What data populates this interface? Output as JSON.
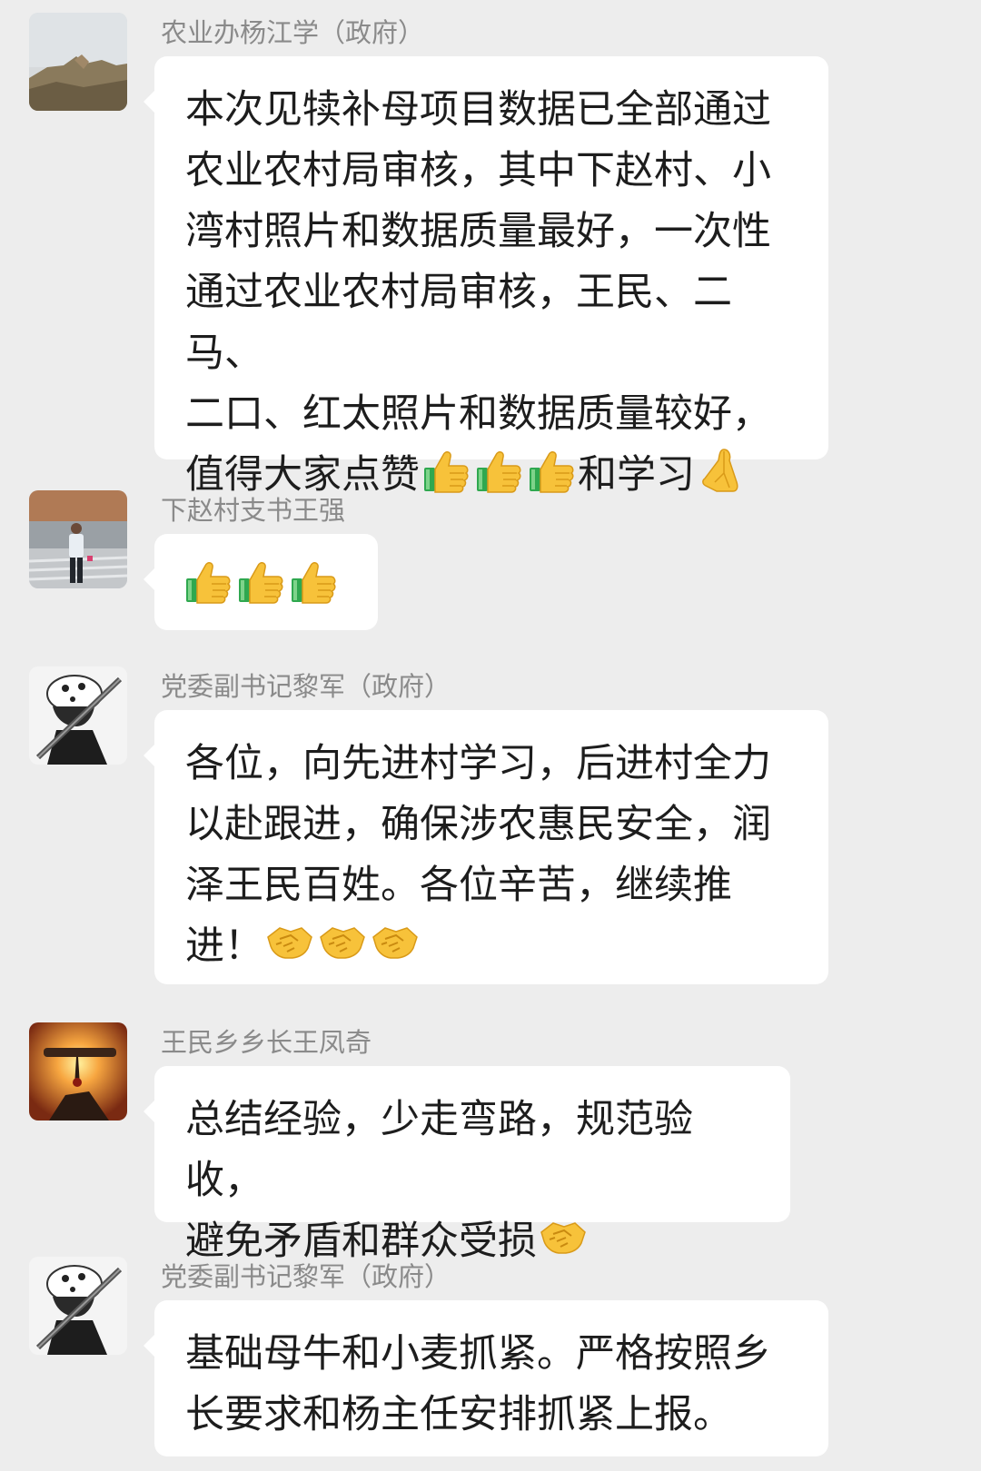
{
  "messages": [
    {
      "sender": "农业办杨江学（政府）",
      "lines": [
        "本次见犊补母项目数据已全部通过",
        "农业农村局审核，其中下赵村、小",
        "湾村照片和数据质量最好，一次性",
        "通过农业农村局审核，王民、二马、",
        "二口、红太照片和数据质量较好，"
      ],
      "last_line_text": "值得大家点赞",
      "last_line_mid": "和学习",
      "emojis": [
        "thumbs-up",
        "thumbs-up",
        "thumbs-up",
        "pray"
      ]
    },
    {
      "sender": "下赵村支书王强",
      "emojis": [
        "thumbs-up",
        "thumbs-up",
        "thumbs-up"
      ]
    },
    {
      "sender": "党委副书记黎军（政府）",
      "lines": [
        "各位，向先进村学习，后进村全力",
        "以赴跟进，确保涉农惠民安全，润",
        "泽王民百姓。各位辛苦，继续推"
      ],
      "last_line_text": "进！",
      "emojis": [
        "handshake",
        "handshake",
        "handshake"
      ]
    },
    {
      "sender": "王民乡乡长王凤奇",
      "lines": [
        "总结经验，少走弯路，规范验收，"
      ],
      "last_line_text": "避免矛盾和群众受损",
      "emojis": [
        "handshake"
      ]
    },
    {
      "sender": "党委副书记黎军（政府）",
      "lines": [
        "基础母牛和小麦抓紧。严格按照乡",
        "长要求和杨主任安排抓紧上报。"
      ]
    }
  ],
  "colors": {
    "background": "#ededed",
    "bubble": "#ffffff",
    "sender": "#8a8a8a",
    "text": "#1d1d1d"
  }
}
